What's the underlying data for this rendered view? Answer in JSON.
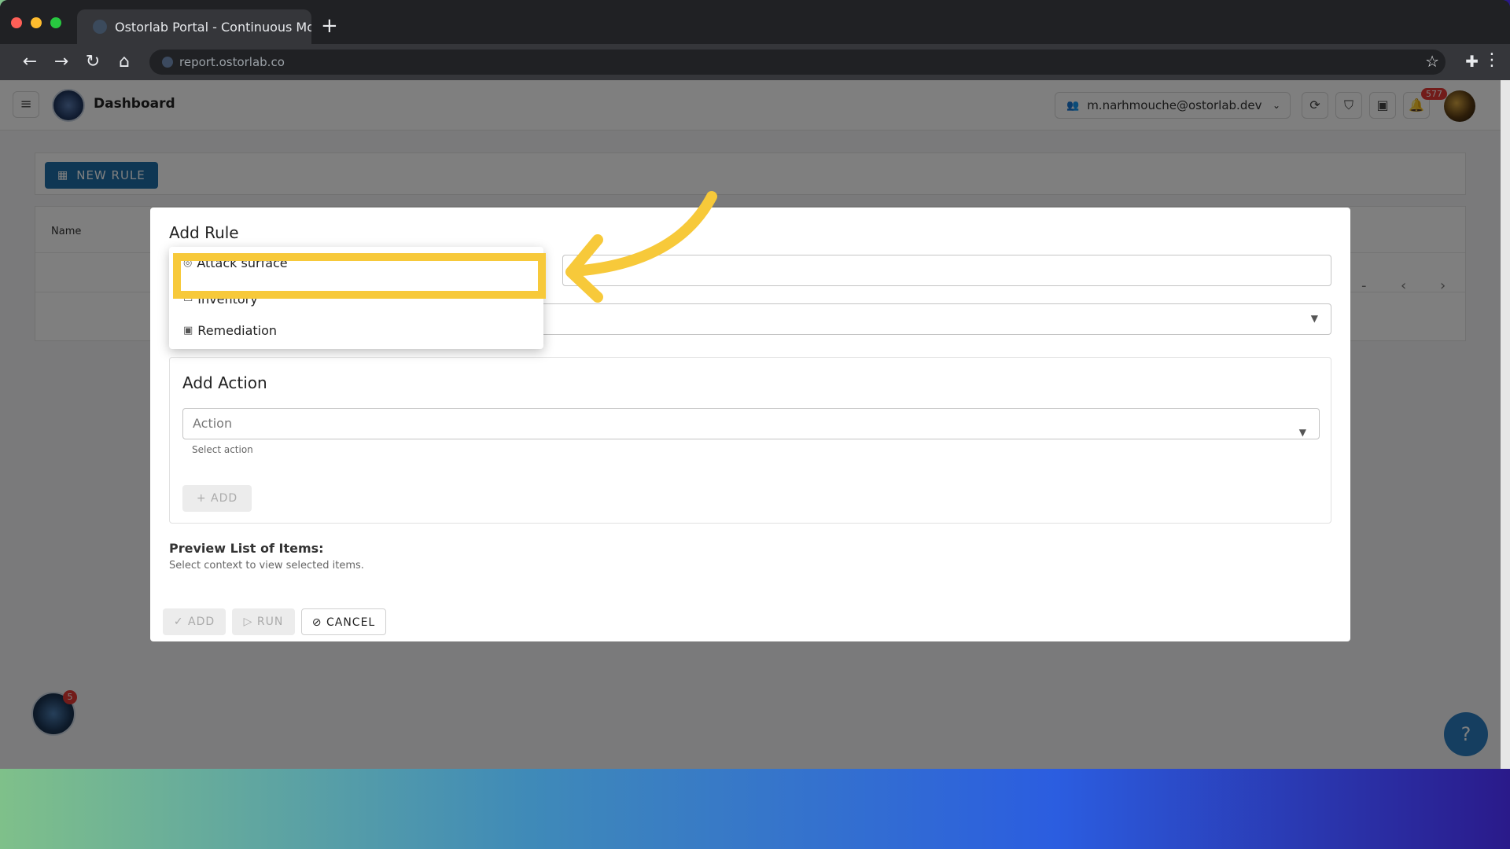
{
  "browser": {
    "tab_title": "Ostorlab Portal - Continuous Mobi",
    "url": "report.ostorlab.co"
  },
  "app": {
    "title": "Dashboard",
    "account": "m.narhmouche@ostorlab.dev",
    "notifications_count": "577",
    "fab_badge": "5",
    "help_label": "?"
  },
  "rules_page": {
    "new_rule_label": "NEW RULE",
    "table_header_name": "Name",
    "pager_dash": "-"
  },
  "dialog": {
    "title": "Add Rule",
    "context_menu": [
      {
        "label": "Attack surface",
        "icon": "attack-surface-icon"
      },
      {
        "label": "Inventory",
        "icon": "calendar-icon"
      },
      {
        "label": "Remediation",
        "icon": "remediation-icon"
      }
    ],
    "action_section_title": "Add Action",
    "action_placeholder": "Action",
    "action_helper": "Select action",
    "add_action_label": "ADD",
    "preview_title": "Preview List of Items:",
    "preview_text": "Select context to view selected items.",
    "buttons": {
      "add": "ADD",
      "run": "RUN",
      "cancel": "CANCEL"
    }
  },
  "colors": {
    "primary": "#1e6fa8",
    "highlight": "#f7c93a",
    "badge": "#e53935"
  }
}
